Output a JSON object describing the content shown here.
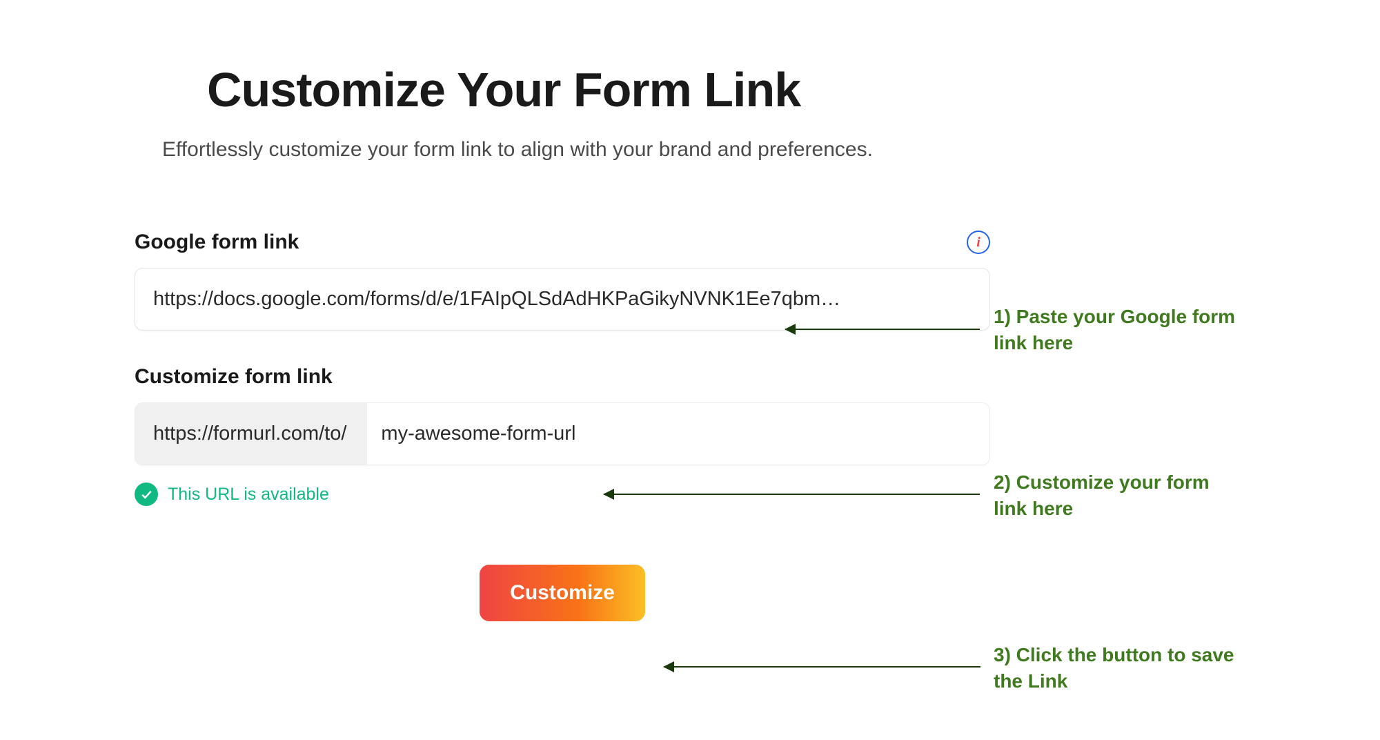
{
  "header": {
    "title": "Customize Your Form Link",
    "subtitle": "Effortlessly customize your form link to align with your brand and preferences."
  },
  "form": {
    "google_link": {
      "label": "Google form link",
      "value": "https://docs.google.com/forms/d/e/1FAIpQLSdAdHKPaGikyNVNK1Ee7qbm…"
    },
    "custom_link": {
      "label": "Customize form link",
      "prefix": "https://formurl.com/to/",
      "value": "my-awesome-form-url"
    },
    "availability": {
      "text": "This URL is available"
    },
    "button_label": "Customize"
  },
  "annotations": {
    "step1": "1) Paste your Google form link here",
    "step2": "2) Customize your form link here",
    "step3": "3) Click the button to save the Link"
  }
}
